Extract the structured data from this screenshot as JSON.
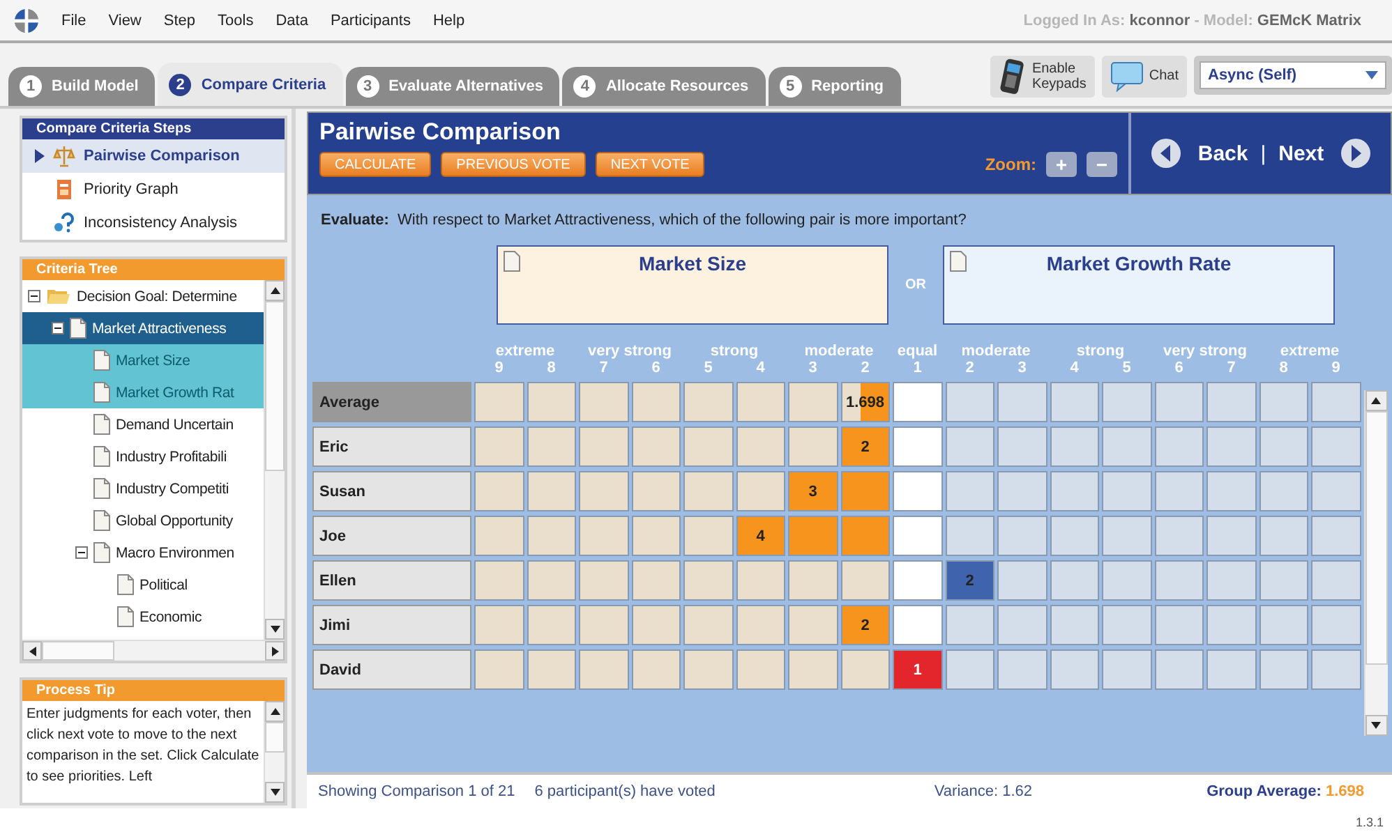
{
  "menu": [
    "File",
    "View",
    "Step",
    "Tools",
    "Data",
    "Participants",
    "Help"
  ],
  "login": {
    "label": "Logged In As:",
    "user": "kconnor",
    "separator": "-",
    "model_label": "Model:",
    "model": "GEMcK Matrix"
  },
  "tabs": [
    {
      "number": "1",
      "label": "Build Model",
      "selected": false
    },
    {
      "number": "2",
      "label": "Compare Criteria",
      "selected": true
    },
    {
      "number": "3",
      "label": "Evaluate Alternatives",
      "selected": false
    },
    {
      "number": "4",
      "label": "Allocate Resources",
      "selected": false
    },
    {
      "number": "5",
      "label": "Reporting",
      "selected": false
    }
  ],
  "toolbar": {
    "keypads": [
      "Enable",
      "Keypads"
    ],
    "chat": "Chat",
    "mode": "Async (Self)"
  },
  "steps": {
    "title": "Compare Criteria Steps",
    "items": [
      {
        "label": "Pairwise Comparison",
        "kind": "scale",
        "selected": true
      },
      {
        "label": "Priority Graph",
        "kind": "graph",
        "selected": false
      },
      {
        "label": "Inconsistency Analysis",
        "kind": "question",
        "selected": false
      }
    ]
  },
  "criteria_tree": {
    "title": "Criteria Tree",
    "items": [
      {
        "label": "Decision Goal: Determine",
        "kind": "folder",
        "expanded": true,
        "selected": false,
        "compared": false,
        "children": [
          {
            "label": "Market Attractiveness",
            "kind": "doc",
            "expanded": true,
            "selected": true,
            "compared": false,
            "children": [
              {
                "label": "Market Size",
                "kind": "doc",
                "selected": false,
                "compared": true
              },
              {
                "label": "Market Growth Rat",
                "kind": "doc",
                "selected": false,
                "compared": true
              },
              {
                "label": "Demand Uncertain",
                "kind": "doc",
                "selected": false,
                "compared": false
              },
              {
                "label": "Industry Profitabili",
                "kind": "doc",
                "selected": false,
                "compared": false
              },
              {
                "label": "Industry Competiti",
                "kind": "doc",
                "selected": false,
                "compared": false
              },
              {
                "label": "Global Opportunity",
                "kind": "doc",
                "selected": false,
                "compared": false
              },
              {
                "label": "Macro Environmen",
                "kind": "doc",
                "expanded": true,
                "selected": false,
                "compared": false,
                "children": [
                  {
                    "label": "Political",
                    "kind": "doc",
                    "selected": false,
                    "compared": false
                  },
                  {
                    "label": "Economic",
                    "kind": "doc",
                    "selected": false,
                    "compared": false
                  }
                ]
              }
            ]
          }
        ]
      }
    ]
  },
  "process_tip": {
    "title": "Process Tip",
    "text": "Enter judgments for each voter, then click next vote to move to the next comparison in the set. Click Calculate to see priorities. Left"
  },
  "header": {
    "title": "Pairwise Comparison",
    "buttons": [
      "CALCULATE",
      "PREVIOUS VOTE",
      "NEXT VOTE"
    ],
    "zoom_label": "Zoom:",
    "zoom_in": "+",
    "zoom_out": "−",
    "back": "Back",
    "divider": "|",
    "next": "Next"
  },
  "evaluate": {
    "label": "Evaluate:",
    "question": "With respect to Market Attractiveness, which of the following pair is more important?"
  },
  "pair": {
    "left": "Market Size",
    "or": "OR",
    "right": "Market Growth Rate"
  },
  "scale_labels": [
    {
      "label": "extreme",
      "kind": "left"
    },
    {
      "label": "very strong",
      "kind": "left"
    },
    {
      "label": "strong",
      "kind": "left"
    },
    {
      "label": "moderate",
      "kind": "left"
    },
    {
      "label": "equal",
      "kind": "equal"
    },
    {
      "label": "moderate",
      "kind": "right"
    },
    {
      "label": "strong",
      "kind": "right"
    },
    {
      "label": "very strong",
      "kind": "right"
    },
    {
      "label": "extreme",
      "kind": "right"
    }
  ],
  "columns": [
    {
      "number": "9",
      "kind": "left"
    },
    {
      "number": "8",
      "kind": "left"
    },
    {
      "number": "7",
      "kind": "left"
    },
    {
      "number": "6",
      "kind": "left"
    },
    {
      "number": "5",
      "kind": "left"
    },
    {
      "number": "4",
      "kind": "left"
    },
    {
      "number": "3",
      "kind": "left"
    },
    {
      "number": "2",
      "kind": "left"
    },
    {
      "number": "1",
      "kind": "equal"
    },
    {
      "number": "2",
      "kind": "right"
    },
    {
      "number": "3",
      "kind": "right"
    },
    {
      "number": "4",
      "kind": "right"
    },
    {
      "number": "5",
      "kind": "right"
    },
    {
      "number": "6",
      "kind": "right"
    },
    {
      "number": "7",
      "kind": "right"
    },
    {
      "number": "8",
      "kind": "right"
    },
    {
      "number": "9",
      "kind": "right"
    }
  ],
  "rows": [
    {
      "name": "Average",
      "kind": "average",
      "cells": [
        {},
        {},
        {},
        {},
        {},
        {},
        {},
        {
          "color": "#f7941d",
          "label": "1.698",
          "level": 0.6
        },
        {},
        {},
        {},
        {},
        {},
        {},
        {},
        {},
        {}
      ]
    },
    {
      "name": "Eric",
      "kind": "voter",
      "cells": [
        {},
        {},
        {},
        {},
        {},
        {},
        {},
        {
          "color": "#f7941d",
          "label": "2"
        },
        {},
        {},
        {},
        {},
        {},
        {},
        {},
        {},
        {}
      ]
    },
    {
      "name": "Susan",
      "kind": "voter",
      "cells": [
        {},
        {},
        {},
        {},
        {},
        {},
        {
          "color": "#f7941d",
          "label": "3"
        },
        {
          "color": "#f7941d"
        },
        {},
        {},
        {},
        {},
        {},
        {},
        {},
        {},
        {}
      ]
    },
    {
      "name": "Joe",
      "kind": "voter",
      "cells": [
        {},
        {},
        {},
        {},
        {},
        {
          "color": "#f7941d",
          "label": "4"
        },
        {
          "color": "#f7941d"
        },
        {
          "color": "#f7941d"
        },
        {},
        {},
        {},
        {},
        {},
        {},
        {},
        {},
        {}
      ]
    },
    {
      "name": "Ellen",
      "kind": "voter",
      "cells": [
        {},
        {},
        {},
        {},
        {},
        {},
        {},
        {},
        {},
        {
          "color": "#3f63ad",
          "label": "2"
        },
        {},
        {},
        {},
        {},
        {},
        {},
        {}
      ]
    },
    {
      "name": "Jimi",
      "kind": "voter",
      "cells": [
        {},
        {},
        {},
        {},
        {},
        {},
        {},
        {
          "color": "#f7941d",
          "label": "2"
        },
        {},
        {},
        {},
        {},
        {},
        {},
        {},
        {},
        {}
      ]
    },
    {
      "name": "David",
      "kind": "voter",
      "cells": [
        {},
        {},
        {},
        {},
        {},
        {},
        {},
        {},
        {
          "color": "#e2262b",
          "label": "1"
        },
        {},
        {},
        {},
        {},
        {},
        {},
        {},
        {}
      ]
    }
  ],
  "status": {
    "showing": "Showing Comparison 1 of 21",
    "voted": "6 participant(s) have voted",
    "variance": "Variance: 1.62",
    "group_label": "Group Average:",
    "group_value": "1.698"
  },
  "version": "1.3.1"
}
